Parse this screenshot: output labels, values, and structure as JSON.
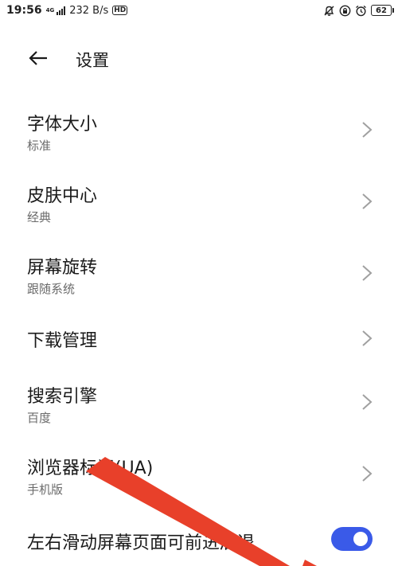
{
  "status_bar": {
    "time": "19:56",
    "network": "4G",
    "speed": "232 B/s",
    "hd": "HD",
    "battery": "62",
    "icons": [
      "bell-off-icon",
      "lock-rotation-icon",
      "alarm-icon",
      "battery-icon"
    ]
  },
  "header": {
    "back_icon": "arrow-left-icon",
    "title": "设置"
  },
  "settings": [
    {
      "title": "字体大小",
      "subtitle": "标准"
    },
    {
      "title": "皮肤中心",
      "subtitle": "经典"
    },
    {
      "title": "屏幕旋转",
      "subtitle": "跟随系统"
    },
    {
      "title": "下载管理",
      "subtitle": ""
    },
    {
      "title": "搜索引擎",
      "subtitle": "百度"
    },
    {
      "title": "浏览器标识(UA)",
      "subtitle": "手机版"
    }
  ],
  "swipe_setting": {
    "title": "左右滑动屏幕页面可前进后退",
    "enabled": true
  },
  "colors": {
    "toggle_on": "#3a5ae8",
    "annotation_arrow": "#e8402a",
    "text_primary": "#1a1a1a",
    "text_secondary": "#6b6b6b",
    "chevron": "#a0a0a0"
  }
}
